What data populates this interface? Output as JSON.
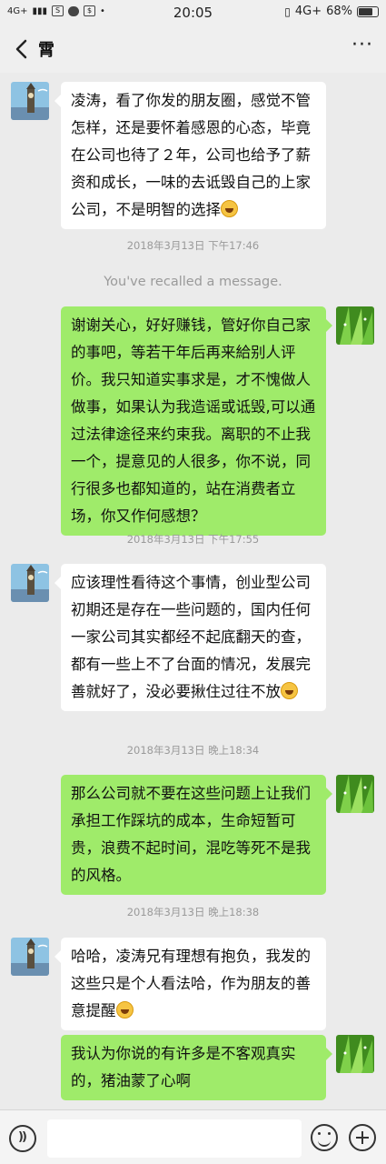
{
  "status_bar": {
    "network_left": "4G+",
    "time": "20:05",
    "network_right": "4G+",
    "battery": "68%"
  },
  "header": {
    "title": "霄",
    "more": "···"
  },
  "messages": [
    {
      "side": "left",
      "text": "凌涛，看了你发的朋友圈，感觉不管怎样，还是要怀着感恩的心态，毕竟在公司也待了２年，公司也给予了薪资和成长，一味的去诋毁自己的上家公司，不是明智的选择",
      "emoji": "face-with-hand-over-mouth"
    },
    {
      "side": "timestamp",
      "text": "2018年3月13日 下午17:46"
    },
    {
      "side": "notice",
      "text": "You've recalled a message."
    },
    {
      "side": "right",
      "text": "谢谢关心，好好赚钱，管好你自己家的事吧，等若干年后再来給别人评价。我只知道实事求是，才不愧做人做事，如果认为我造谣或诋毁,可以通过法律途径来约束我。离职的不止我一个，提意见的人很多，你不说，同行很多也都知道的，站在消费者立场，你又作何感想？"
    },
    {
      "side": "timestamp",
      "text": "2018年3月13日 下午17:55"
    },
    {
      "side": "left",
      "text": "应该理性看待这个事情，创业型公司初期还是存在一些问题的，国内任何一家公司其实都经不起底翻天的查，都有一些上不了台面的情况，发展完善就好了，没必要揪住过往不放",
      "emoji": "smiling-face"
    },
    {
      "side": "timestamp",
      "text": "2018年3月13日 晚上18:34"
    },
    {
      "side": "right",
      "text": "那么公司就不要在这些问题上让我们承担工作踩坑的成本，生命短暂可贵，浪费不起时间，混吃等死不是我的风格。"
    },
    {
      "side": "timestamp",
      "text": "2018年3月13日 晚上18:38"
    },
    {
      "side": "left",
      "text": "哈哈，凌涛兄有理想有抱负，我发的这些只是个人看法哈，作为朋友的善意提醒",
      "emoji": "grinning-face"
    },
    {
      "side": "right",
      "text": "我认为你说的有许多是不客观真实的，猪油蒙了心啊"
    }
  ],
  "input_bar": {
    "voice_icon": "voice-icon",
    "emoji_icon": "emoji-icon",
    "plus_icon": "plus-icon"
  },
  "colors": {
    "background": "#ebebeb",
    "bubble_mine": "#9feb6a",
    "bubble_theirs": "#ffffff"
  }
}
